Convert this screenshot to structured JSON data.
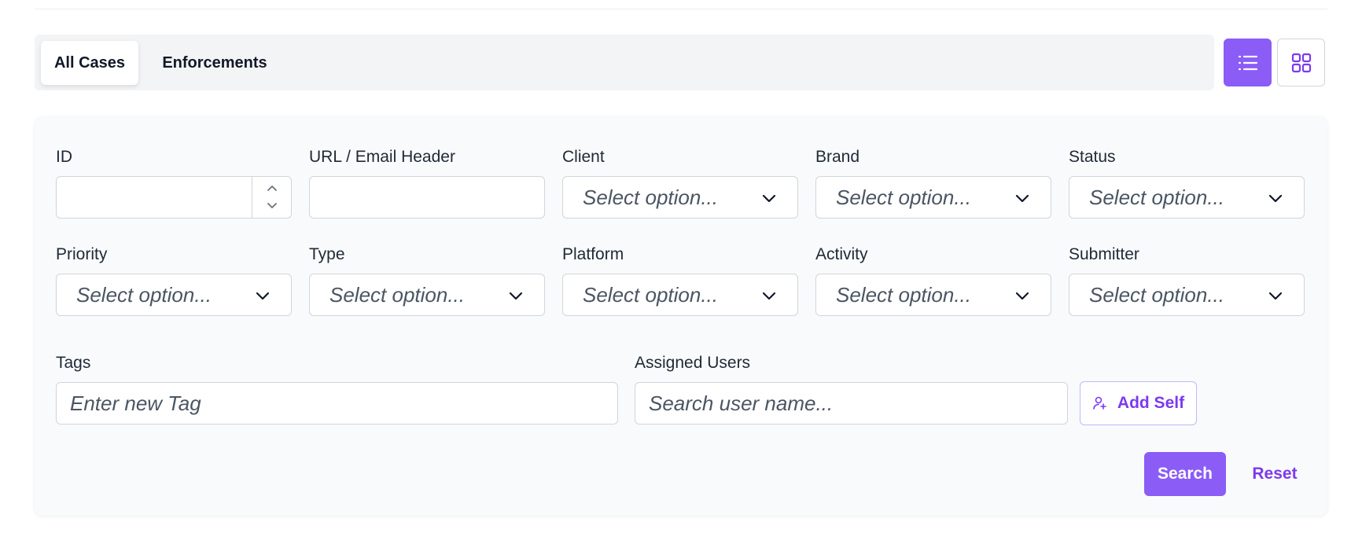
{
  "tabs": [
    {
      "label": "All Cases",
      "active": true
    },
    {
      "label": "Enforcements",
      "active": false
    }
  ],
  "view_toggle": {
    "list_icon": "list-icon",
    "grid_icon": "grid-icon",
    "active": "list"
  },
  "filters": {
    "id": {
      "label": "ID",
      "value": ""
    },
    "url": {
      "label": "URL / Email Header",
      "value": ""
    },
    "client": {
      "label": "Client",
      "placeholder": "Select option..."
    },
    "brand": {
      "label": "Brand",
      "placeholder": "Select option..."
    },
    "status": {
      "label": "Status",
      "placeholder": "Select option..."
    },
    "priority": {
      "label": "Priority",
      "placeholder": "Select option..."
    },
    "type": {
      "label": "Type",
      "placeholder": "Select option..."
    },
    "platform": {
      "label": "Platform",
      "placeholder": "Select option..."
    },
    "activity": {
      "label": "Activity",
      "placeholder": "Select option..."
    },
    "submitter": {
      "label": "Submitter",
      "placeholder": "Select option..."
    },
    "tags": {
      "label": "Tags",
      "placeholder": "Enter new Tag"
    },
    "assigned_users": {
      "label": "Assigned Users",
      "placeholder": "Search user name..."
    }
  },
  "buttons": {
    "add_self": "Add Self",
    "search": "Search",
    "reset": "Reset"
  },
  "colors": {
    "accent": "#8b5cf6",
    "accent_text": "#7c3aed",
    "panel_bg": "#f9fafb",
    "tabbar_bg": "#f3f4f6"
  }
}
